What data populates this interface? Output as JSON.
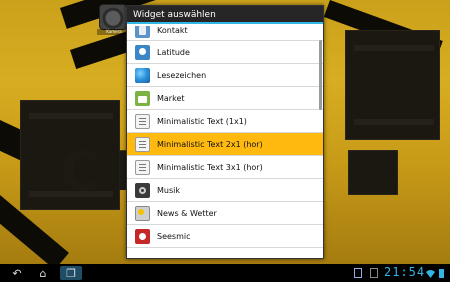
{
  "desktop": {
    "wallpaper_accent": "#d7ad21",
    "wallpaper_text": "C     ION",
    "shortcut_icon": "camera-icon",
    "shortcut_label": "Kamera"
  },
  "dialog": {
    "title": "Widget auswählen",
    "items": [
      {
        "label": "Kontakt",
        "icon": "contact-icon",
        "selected": false
      },
      {
        "label": "Latitude",
        "icon": "latitude-icon",
        "selected": false
      },
      {
        "label": "Lesezeichen",
        "icon": "bookmarks-icon",
        "selected": false
      },
      {
        "label": "Market",
        "icon": "market-icon",
        "selected": false
      },
      {
        "label": "Minimalistic Text (1x1)",
        "icon": "document-icon",
        "selected": false
      },
      {
        "label": "Minimalistic Text 2x1 (hor)",
        "icon": "document-icon",
        "selected": true
      },
      {
        "label": "Minimalistic Text 3x1 (hor)",
        "icon": "document-icon",
        "selected": false
      },
      {
        "label": "Musik",
        "icon": "music-icon",
        "selected": false
      },
      {
        "label": "News & Wetter",
        "icon": "news-icon",
        "selected": false
      },
      {
        "label": "Seesmic",
        "icon": "seesmic-icon",
        "selected": false
      }
    ],
    "selected_color": "#ffb90f"
  },
  "navbar": {
    "back": "↶",
    "home": "⌂",
    "recent": "❐",
    "time": "21:54",
    "clock_color": "#33b5e5"
  }
}
